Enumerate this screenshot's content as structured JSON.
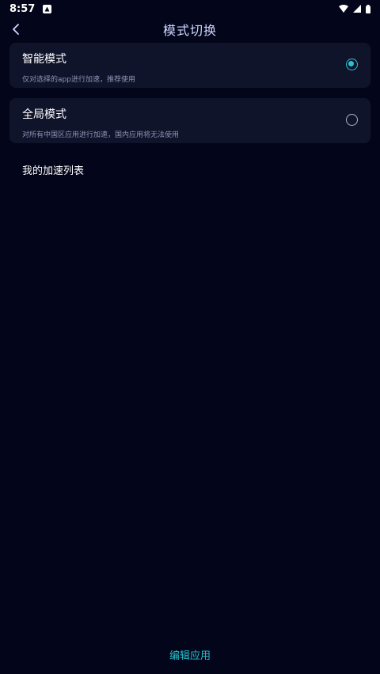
{
  "status_bar": {
    "time": "8:57"
  },
  "header": {
    "title": "模式切换"
  },
  "modes": [
    {
      "title": "智能模式",
      "desc": "仅对选择的app进行加速，推荐使用",
      "selected": true
    },
    {
      "title": "全局模式",
      "desc": "对所有中国区应用进行加速，国内应用将无法使用",
      "selected": false
    }
  ],
  "list": {
    "title": "我的加速列表"
  },
  "footer": {
    "edit_label": "编辑应用"
  },
  "colors": {
    "background": "#03051a",
    "card": "#10142b",
    "accent": "#26c4cf",
    "title": "#cfd6ff"
  }
}
